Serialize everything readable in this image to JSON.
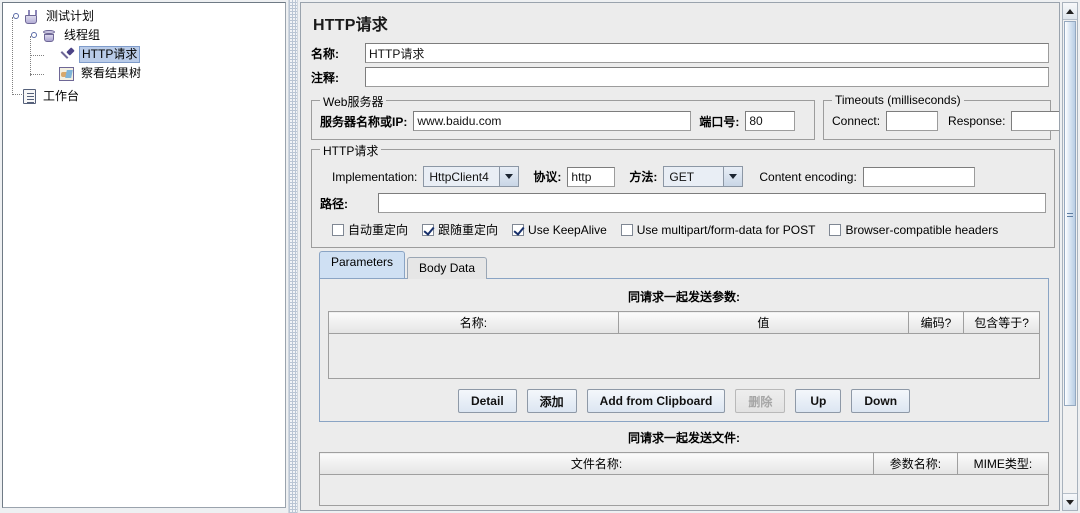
{
  "tree": {
    "nodes": [
      {
        "label": "测试计划",
        "icon": "flask-icon",
        "selected": false
      },
      {
        "label": "线程组",
        "icon": "thread-group-icon",
        "selected": false
      },
      {
        "label": "HTTP请求",
        "icon": "http-request-icon",
        "selected": true
      },
      {
        "label": "察看结果树",
        "icon": "view-results-tree-icon",
        "selected": false
      },
      {
        "label": "工作台",
        "icon": "workbench-icon",
        "selected": false
      }
    ]
  },
  "panel": {
    "title": "HTTP请求",
    "name_label": "名称:",
    "name_value": "HTTP请求",
    "comment_label": "注释:",
    "comment_value": ""
  },
  "web_server": {
    "group_title": "Web服务器",
    "server_label": "服务器名称或IP:",
    "server_value": "www.baidu.com",
    "port_label": "端口号:",
    "port_value": "80"
  },
  "timeouts": {
    "group_title": "Timeouts (milliseconds)",
    "connect_label": "Connect:",
    "connect_value": "",
    "response_label": "Response:",
    "response_value": ""
  },
  "http_request": {
    "group_title": "HTTP请求",
    "implementation_label": "Implementation:",
    "implementation_value": "HttpClient4",
    "protocol_label": "协议:",
    "protocol_value": "http",
    "method_label": "方法:",
    "method_value": "GET",
    "content_encoding_label": "Content encoding:",
    "content_encoding_value": "",
    "path_label": "路径:",
    "path_value": "",
    "checkboxes": [
      {
        "label": "自动重定向",
        "checked": false
      },
      {
        "label": "跟随重定向",
        "checked": true
      },
      {
        "label": "Use KeepAlive",
        "checked": true
      },
      {
        "label": "Use multipart/form-data for POST",
        "checked": false
      },
      {
        "label": "Browser-compatible headers",
        "checked": false
      }
    ]
  },
  "tabs": [
    {
      "label": "Parameters",
      "active": true
    },
    {
      "label": "Body Data",
      "active": false
    }
  ],
  "parameters": {
    "section_title": "同请求一起发送参数:",
    "columns": [
      "名称:",
      "值",
      "编码?",
      "包含等于?"
    ],
    "rows": [],
    "buttons": [
      {
        "label": "Detail",
        "enabled": true
      },
      {
        "label": "添加",
        "enabled": true
      },
      {
        "label": "Add from Clipboard",
        "enabled": true
      },
      {
        "label": "删除",
        "enabled": false
      },
      {
        "label": "Up",
        "enabled": true
      },
      {
        "label": "Down",
        "enabled": true
      }
    ]
  },
  "files": {
    "section_title": "同请求一起发送文件:",
    "columns": [
      "文件名称:",
      "参数名称:",
      "MIME类型:"
    ],
    "rows": []
  },
  "colors": {
    "panel_bg": "#ececec",
    "selection_blue": "#b9cbe8",
    "tab_active": "#cfe0f3",
    "border": "#9c9c9c"
  }
}
